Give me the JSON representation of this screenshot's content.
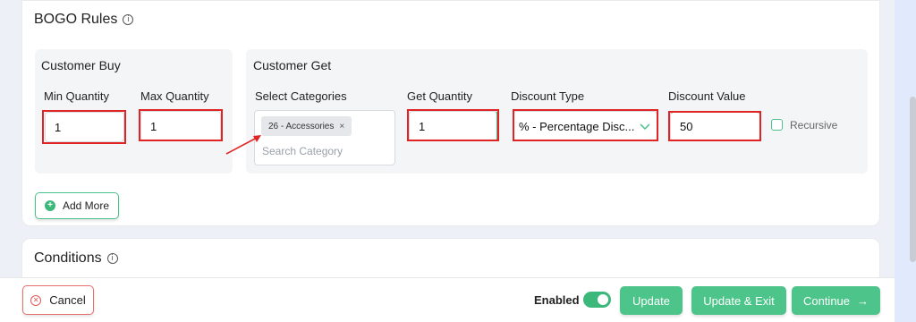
{
  "bogo": {
    "title": "BOGO Rules",
    "info_icon": "info-icon",
    "customer_buy": {
      "title": "Customer Buy",
      "min_label": "Min Quantity",
      "min_value": "1",
      "max_label": "Max Quantity",
      "max_value": "1"
    },
    "customer_get": {
      "title": "Customer Get",
      "categories_label": "Select Categories",
      "selected_tag": "26 - Accessories",
      "tag_remove": "×",
      "search_placeholder": "Search Category",
      "get_qty_label": "Get Quantity",
      "get_qty_value": "1",
      "discount_type_label": "Discount Type",
      "discount_type_value": "% - Percentage Disc...",
      "discount_value_label": "Discount Value",
      "discount_value": "50",
      "recursive_label": "Recursive",
      "recursive_checked": false
    },
    "add_more_label": "Add More"
  },
  "conditions": {
    "title": "Conditions"
  },
  "footer": {
    "cancel_label": "Cancel",
    "enabled_label": "Enabled",
    "enabled_on": true,
    "update_label": "Update",
    "update_exit_label": "Update & Exit",
    "continue_label": "Continue",
    "continue_arrow": "→"
  },
  "colors": {
    "accent_green": "#4cc48a",
    "highlight_red": "#e02424"
  }
}
